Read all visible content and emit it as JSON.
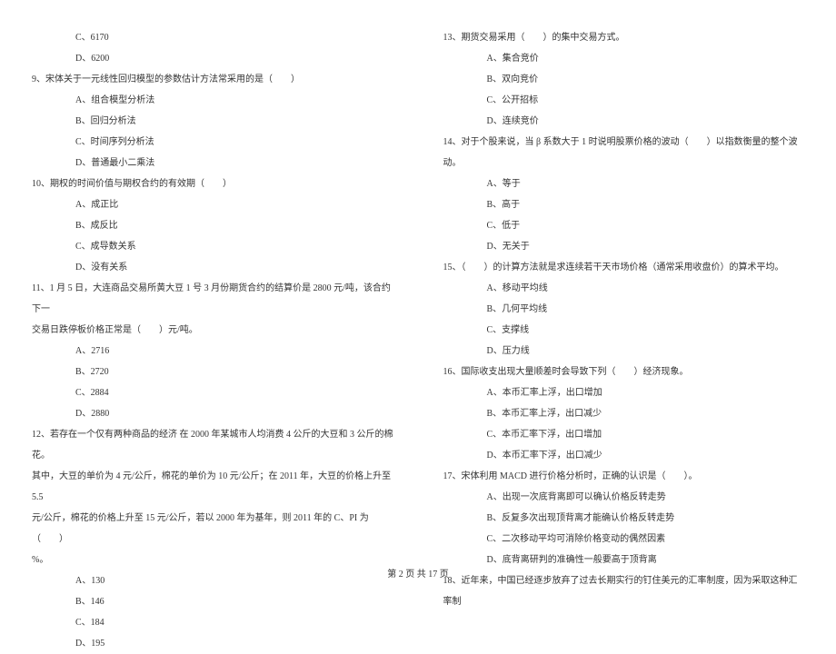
{
  "left": {
    "optC_8": "C、6170",
    "optD_8": "D、6200",
    "q9": "9、宋体关于一元线性回归模型的参数估计方法常采用的是（　　）",
    "q9_A": "A、组合模型分析法",
    "q9_B": "B、回归分析法",
    "q9_C": "C、时间序列分析法",
    "q9_D": "D、普通最小二乘法",
    "q10": "10、期权的时间价值与期权合约的有效期（　　）",
    "q10_A": "A、成正比",
    "q10_B": "B、成反比",
    "q10_C": "C、成导数关系",
    "q10_D": "D、没有关系",
    "q11": "11、1 月 5 日，大连商品交易所黄大豆 1 号 3 月份期货合约的结算价是 2800 元/吨，该合约下一",
    "q11_cont": "交易日跌停板价格正常是（　　）元/吨。",
    "q11_A": "A、2716",
    "q11_B": "B、2720",
    "q11_C": "C、2884",
    "q11_D": "D、2880",
    "q12": "12、若存在一个仅有两种商品的经济 在 2000 年某城市人均消费 4 公斤的大豆和 3 公斤的棉花。",
    "q12_cont1": "其中，大豆的单价为 4 元/公斤，棉花的单价为 10 元/公斤；在 2011 年，大豆的价格上升至 5.5",
    "q12_cont2": "元/公斤，棉花的价格上升至 15 元/公斤，若以 2000 年为基年，则 2011 年的 C、PI 为（　　）",
    "q12_cont3": "%。",
    "q12_A": "A、130",
    "q12_B": "B、146",
    "q12_C": "C、184",
    "q12_D": "D、195"
  },
  "right": {
    "q13": "13、期货交易采用（　　）的集中交易方式。",
    "q13_A": "A、集合竞价",
    "q13_B": "B、双向竞价",
    "q13_C": "C、公开招标",
    "q13_D": "D、连续竞价",
    "q14": "14、对于个股来说，当 β 系数大于 1 时说明股票价格的波动（　　）以指数衡量的整个波动。",
    "q14_A": "A、等于",
    "q14_B": "B、高于",
    "q14_C": "C、低于",
    "q14_D": "D、无关于",
    "q15": "15、（　　）的计算方法就是求连续若干天市场价格（通常采用收盘价）的算术平均。",
    "q15_A": "A、移动平均线",
    "q15_B": "B、几何平均线",
    "q15_C": "C、支撑线",
    "q15_D": "D、压力线",
    "q16": "16、国际收支出现大量顺差时会导致下列（　　）经济现象。",
    "q16_A": "A、本币汇率上浮，出口增加",
    "q16_B": "B、本币汇率上浮，出口减少",
    "q16_C": "C、本币汇率下浮，出口增加",
    "q16_D": "D、本币汇率下浮，出口减少",
    "q17": "17、宋体利用 MACD 进行价格分析时，正确的认识是（　　）。",
    "q17_A": "A、出现一次底背离即可以确认价格反转走势",
    "q17_B": "B、反复多次出现顶背离才能确认价格反转走势",
    "q17_C": "C、二次移动平均可消除价格变动的偶然因素",
    "q17_D": "D、底背离研判的准确性一般要高于顶背离",
    "q18": "18、近年来，中国已经逐步放弃了过去长期实行的钉住美元的汇率制度，因为采取这种汇率制"
  },
  "footer": "第 2 页 共 17 页"
}
